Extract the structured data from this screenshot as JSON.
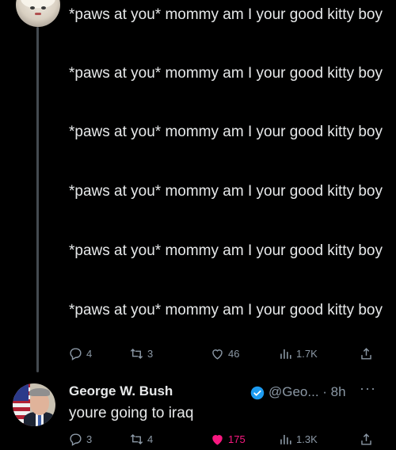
{
  "parent_tweet": {
    "paragraphs": [
      "*paws at you* mommy am I your good kitty boy",
      "*paws at you* mommy am I your good kitty boy",
      "*paws at you* mommy am I your good kitty boy",
      "*paws at you* mommy am I your good kitty boy",
      "*paws at you* mommy am I your good kitty boy",
      "*paws at you* mommy am I your good kitty boy"
    ],
    "stats": {
      "replies": "4",
      "retweets": "3",
      "likes": "46",
      "views": "1.7K"
    }
  },
  "reply_tweet": {
    "author_name": "George W. Bush",
    "handle_time": "@Geo... · 8h",
    "more": "···",
    "text": "youre going to iraq",
    "stats": {
      "replies": "3",
      "retweets": "4",
      "likes": "175",
      "views": "1.3K"
    },
    "liked": true
  },
  "colors": {
    "background": "#000000",
    "text": "#e7e9ea",
    "muted": "#8b98a5",
    "like_active": "#f91880",
    "verified": "#1d9bf0"
  },
  "icons": [
    "reply-icon",
    "retweet-icon",
    "like-icon",
    "views-icon",
    "share-icon",
    "verified-icon",
    "more-icon"
  ]
}
